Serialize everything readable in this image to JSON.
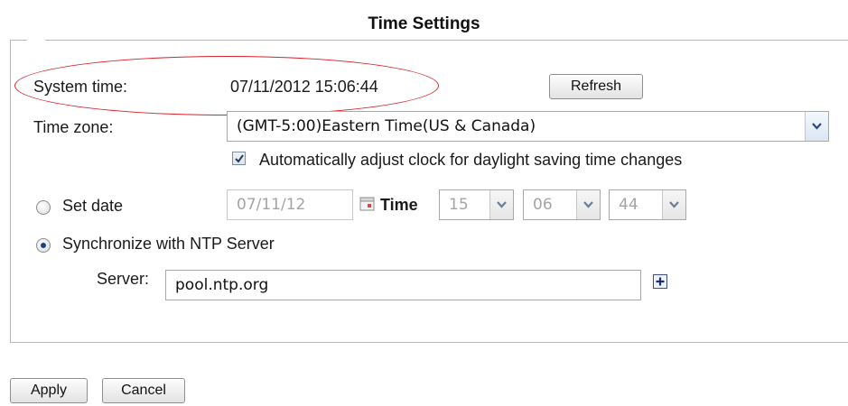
{
  "page": {
    "title": "Time Settings"
  },
  "system_time": {
    "label": "System time:",
    "value": "07/11/2012 15:06:44",
    "refresh_label": "Refresh"
  },
  "time_zone": {
    "label": "Time zone:",
    "selected": "(GMT-5:00)Eastern Time(US & Canada)"
  },
  "dst": {
    "checked": true,
    "label": "Automatically adjust clock for daylight saving time changes"
  },
  "set_date": {
    "selected": false,
    "label": "Set date",
    "date_value": "07/11/12",
    "time_label": "Time",
    "hour": "15",
    "minute": "06",
    "second": "44"
  },
  "ntp": {
    "selected": true,
    "label": "Synchronize with NTP Server",
    "server_label": "Server:",
    "server_value": "pool.ntp.org"
  },
  "footer": {
    "apply_label": "Apply",
    "cancel_label": "Cancel"
  },
  "colors": {
    "highlight": "#d8232a",
    "radio_dot": "#1f3f8a",
    "panel_border": "#b8b8b8"
  },
  "icons": {
    "calendar": "calendar-icon",
    "add_server": "plus-box-icon",
    "dropdown": "chevron-down-icon"
  }
}
